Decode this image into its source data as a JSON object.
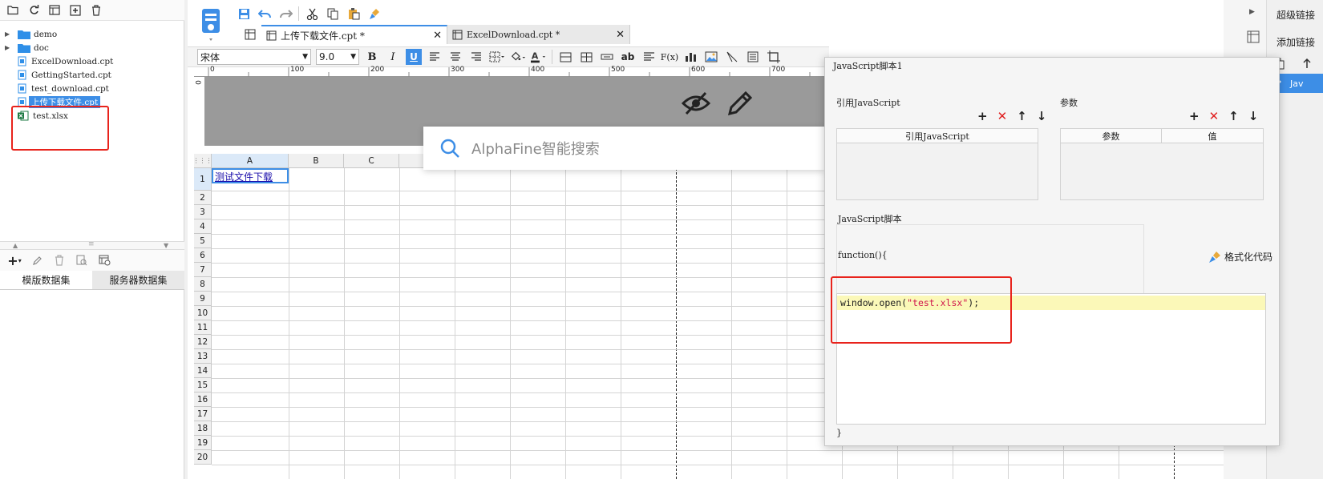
{
  "left_panel": {
    "tree": [
      {
        "label": "demo",
        "type": "folder"
      },
      {
        "label": "doc",
        "type": "folder"
      },
      {
        "label": "ExcelDownload.cpt",
        "type": "cpt"
      },
      {
        "label": "GettingStarted.cpt",
        "type": "cpt"
      },
      {
        "label": "test_download.cpt",
        "type": "cpt"
      },
      {
        "label": "上传下载文件.cpt",
        "type": "cpt",
        "selected": true
      },
      {
        "label": "test.xlsx",
        "type": "xlsx"
      }
    ],
    "dataset_tabs": [
      "模版数据集",
      "服务器数据集"
    ]
  },
  "tabs": [
    {
      "label": "上传下载文件.cpt *",
      "active": true
    },
    {
      "label": "ExcelDownload.cpt *",
      "active": false
    }
  ],
  "format": {
    "font_name": "宋体",
    "font_size": "9.0"
  },
  "ruler": {
    "marks": [
      "0",
      "100",
      "200",
      "300",
      "400",
      "500",
      "600",
      "700"
    ],
    "vmark": "0"
  },
  "grid": {
    "columns": [
      "A",
      "B",
      "C"
    ],
    "rows": [
      "1",
      "2",
      "3",
      "4",
      "5",
      "6",
      "7",
      "8",
      "9",
      "10",
      "11",
      "12",
      "13",
      "14",
      "15",
      "16",
      "17",
      "18",
      "19",
      "20"
    ],
    "cell_a1": "测试文件下载"
  },
  "search": {
    "placeholder": "AlphaFine智能搜索"
  },
  "dialog": {
    "title": "JavaScript脚本1",
    "ref_label": "引用JavaScript",
    "ref_col": "引用JavaScript",
    "param_label": "参数",
    "param_col1": "参数",
    "param_col2": "值",
    "script_label": "JavaScript脚本",
    "func_open": "function(){",
    "format_code": "格式化代码",
    "code_plain1": "window.open(",
    "code_string": "\"test.xlsx\"",
    "code_plain2": ");",
    "func_close": "}"
  },
  "right_panel": {
    "hyperlink": "超级链接",
    "add_link": "添加链接",
    "list_item": "Jav"
  },
  "colors": {
    "accent": "#3d8ee6",
    "annotation_red": "#e8231c",
    "delete_red": "#e02020",
    "string_red": "#d0154d",
    "highlight_line": "#fbf8b8"
  }
}
